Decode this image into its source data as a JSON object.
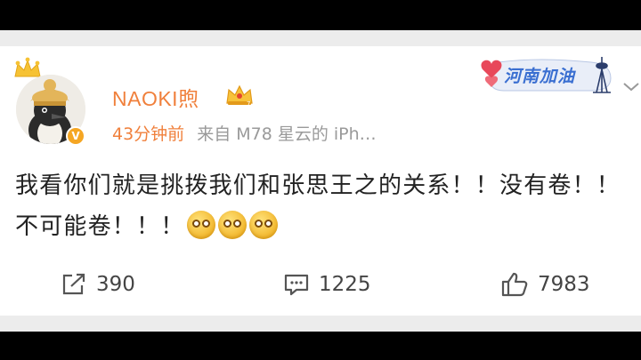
{
  "post": {
    "username": "NAOKI煦",
    "time": "43分钟前",
    "source": "来自 M78 星云的 iPh…",
    "text": "我看你们就是挑拨我们和张思王之的关系！！没有卷！！不可能卷！！！",
    "emoji_count": 3
  },
  "campaign_tag": "河南加油",
  "actions": {
    "share_count": "390",
    "comment_count": "1225",
    "like_count": "7983"
  },
  "icons": {
    "crown": "crown-icon",
    "vip": "vip-crown-icon",
    "verified": "verified-badge-icon",
    "chevron": "chevron-down-icon",
    "share": "share-icon",
    "comment": "comment-icon",
    "like": "thumbs-up-icon"
  },
  "colors": {
    "username": "#f0803c",
    "meta": "#9a9a9a",
    "campaign": "#3a6fd1",
    "heart": "#e8485a"
  }
}
